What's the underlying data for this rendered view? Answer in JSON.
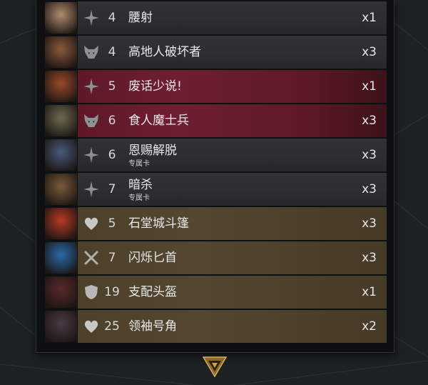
{
  "deck": {
    "cards": [
      {
        "cost": "4",
        "name": "腰射",
        "tag": "",
        "count": "x1",
        "type": "spell-icon",
        "row": "normal",
        "portrait_color": "#b08a6e"
      },
      {
        "cost": "4",
        "name": "高地人破坏者",
        "tag": "",
        "count": "x3",
        "type": "creep-icon",
        "row": "normal",
        "portrait_color": "#8a5a3a"
      },
      {
        "cost": "5",
        "name": "废话少说!",
        "tag": "",
        "count": "x1",
        "type": "spell-icon",
        "row": "hero",
        "portrait_color": "#9a4a2a"
      },
      {
        "cost": "6",
        "name": "食人魔士兵",
        "tag": "",
        "count": "x3",
        "type": "creep-icon",
        "row": "hero",
        "portrait_color": "#6e6a50"
      },
      {
        "cost": "6",
        "name": "恩赐解脱",
        "tag": "专属卡",
        "count": "x3",
        "type": "spell-icon",
        "row": "normal",
        "portrait_color": "#4a5a7a"
      },
      {
        "cost": "7",
        "name": "暗杀",
        "tag": "专属卡",
        "count": "x3",
        "type": "spell-icon",
        "row": "normal",
        "portrait_color": "#7a5a3a"
      },
      {
        "cost": "5",
        "name": "石堂城斗篷",
        "tag": "",
        "count": "x3",
        "type": "heart-icon",
        "row": "item",
        "portrait_color": "#b83a24"
      },
      {
        "cost": "7",
        "name": "闪烁匕首",
        "tag": "",
        "count": "x3",
        "type": "weapon-icon",
        "row": "item",
        "portrait_color": "#2a6aa8"
      },
      {
        "cost": "19",
        "name": "支配头盔",
        "tag": "",
        "count": "x1",
        "type": "armor-icon",
        "row": "item",
        "portrait_color": "#5a2a2a"
      },
      {
        "cost": "25",
        "name": "领袖号角",
        "tag": "",
        "count": "x2",
        "type": "heart-icon",
        "row": "item",
        "portrait_color": "#4a3a44"
      }
    ]
  },
  "colors": {
    "hero_row": "#6e1f31",
    "item_row": "#544631",
    "normal_row": "#2c2e30",
    "accent_gold": "#b8963a"
  }
}
